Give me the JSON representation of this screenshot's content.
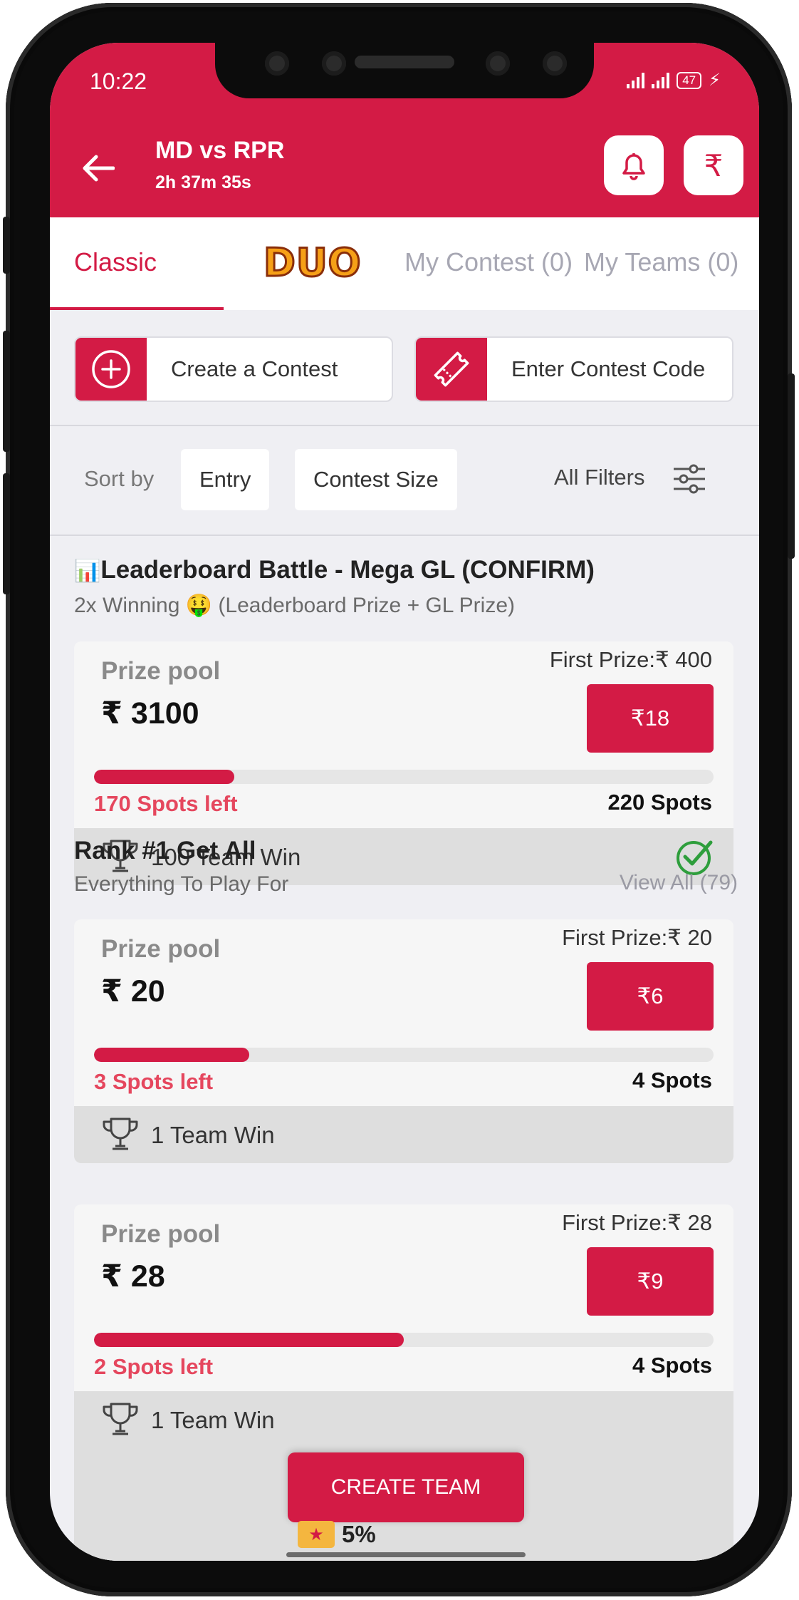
{
  "status_bar": {
    "time": "10:22",
    "battery": "47"
  },
  "header": {
    "title": "MD vs RPR",
    "timer": "2h 37m 35s",
    "currency_symbol": "₹"
  },
  "tabs": {
    "classic": "Classic",
    "duo": "DUO",
    "my_contest": "My Contest (0)",
    "my_teams": "My Teams (0)"
  },
  "actions": {
    "create_contest": "Create a Contest",
    "enter_code": "Enter Contest Code"
  },
  "sort": {
    "label": "Sort by",
    "entry": "Entry",
    "contest_size": "Contest Size",
    "all_filters": "All Filters"
  },
  "section1": {
    "title": "Leaderboard Battle - Mega GL (CONFIRM)",
    "subtitle": "2x Winning 🤑 (Leaderboard Prize + GL Prize)",
    "card": {
      "prize_label": "Prize pool",
      "prize_value": "₹ 3100",
      "first_prize": "First Prize:₹ 400",
      "entry": "₹18",
      "spots_left": "170 Spots left",
      "spots_total": "220 Spots",
      "fill_fraction": 0.227,
      "wins": "100 Team Win"
    }
  },
  "section2": {
    "title": "Rank #1 Get All",
    "subtitle": "Everything To Play For",
    "view_all": "View All (79)",
    "cards": [
      {
        "prize_label": "Prize pool",
        "prize_value": "₹ 20",
        "first_prize": "First Prize:₹ 20",
        "entry": "₹6",
        "spots_left": "3 Spots left",
        "spots_total": "4 Spots",
        "fill_fraction": 0.25,
        "wins": "1 Team Win"
      },
      {
        "prize_label": "Prize pool",
        "prize_value": "₹ 28",
        "first_prize": "First Prize:₹ 28",
        "entry": "₹9",
        "spots_left": "2 Spots left",
        "spots_total": "4 Spots",
        "fill_fraction": 0.5,
        "wins": "1 Team Win"
      }
    ]
  },
  "bonus": "5%",
  "create_team": "CREATE TEAM",
  "colors": {
    "primary": "#d31b45",
    "spots_left": "#e5475e",
    "check": "#2e9e3c"
  }
}
